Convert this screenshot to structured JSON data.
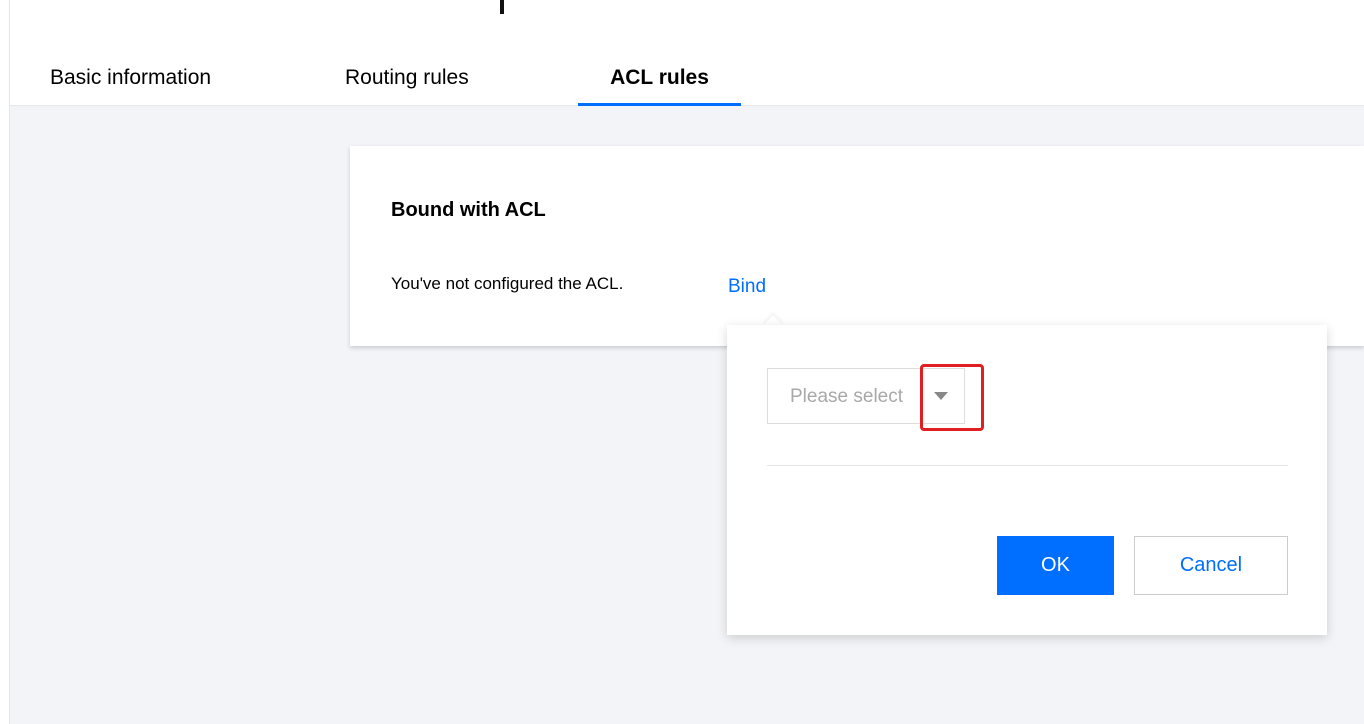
{
  "tabs": [
    {
      "label": "Basic information",
      "active": false
    },
    {
      "label": "Routing rules",
      "active": false
    },
    {
      "label": "ACL rules",
      "active": true
    }
  ],
  "acl_card": {
    "title": "Bound with ACL",
    "message": "You've not configured the ACL.",
    "bind_link": "Bind"
  },
  "bind_popover": {
    "select_placeholder": "Please select",
    "caret_icon": "chevron-down-icon",
    "ok_label": "OK",
    "cancel_label": "Cancel"
  },
  "colors": {
    "accent": "#006eff",
    "highlight": "#e02020",
    "page_background": "#f3f4f7"
  }
}
